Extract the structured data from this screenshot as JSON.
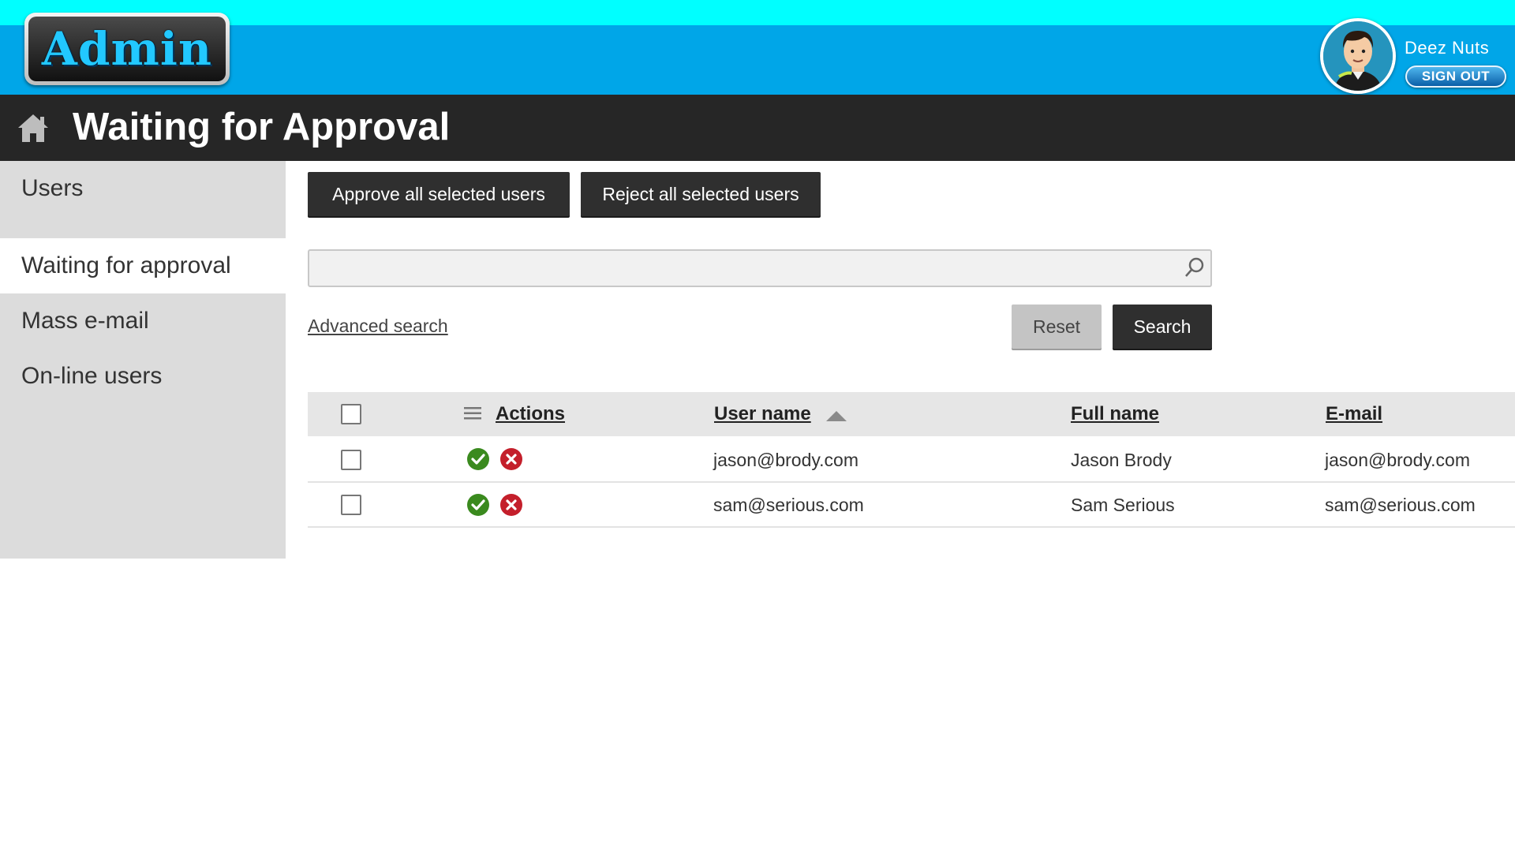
{
  "header": {
    "logo_text": "Admin",
    "user_name": "Deez Nuts",
    "signout_label": "SIGN OUT"
  },
  "title_bar": {
    "title": "Waiting for Approval"
  },
  "sidebar": {
    "items": [
      {
        "label": "Users",
        "active": false
      },
      {
        "label": "Waiting for approval",
        "active": true
      },
      {
        "label": "Mass e-mail",
        "active": false
      },
      {
        "label": "On-line users",
        "active": false
      }
    ]
  },
  "toolbar": {
    "approve_label": "Approve all selected users",
    "reject_label": "Reject all selected users"
  },
  "search": {
    "value": "",
    "placeholder": "",
    "advanced_label": "Advanced search",
    "reset_label": "Reset",
    "search_label": "Search"
  },
  "table": {
    "columns": {
      "actions": "Actions",
      "username": "User name",
      "fullname": "Full name",
      "email": "E-mail"
    },
    "sort": {
      "column": "User name",
      "direction": "ascending"
    },
    "rows": [
      {
        "username": "jason@brody.com",
        "fullname": "Jason Brody",
        "email": "jason@brody.com",
        "checked": false
      },
      {
        "username": "sam@serious.com",
        "fullname": "Sam Serious",
        "email": "sam@serious.com",
        "checked": false
      }
    ]
  },
  "colors": {
    "top_strip": "#00ffff",
    "banner": "#00a6e8",
    "title_bar": "#262626",
    "sidebar": "#dcdcdc",
    "approve_icon": "#3a8a1e",
    "reject_icon": "#c41f2b"
  },
  "icons": {
    "home": "home-icon",
    "search": "search-icon",
    "column_menu": "menu-icon",
    "approve": "check-circle-icon",
    "reject": "x-circle-icon",
    "sort": "sort-up-icon"
  }
}
